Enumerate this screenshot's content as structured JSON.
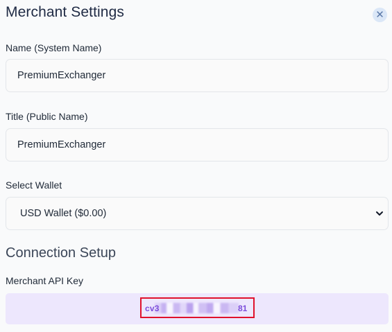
{
  "modal": {
    "title": "Merchant Settings",
    "close_icon": "close-icon"
  },
  "form": {
    "name_label": "Name (System Name)",
    "name_value": "PremiumExchanger",
    "title_label": "Title (Public Name)",
    "title_value": "PremiumExchanger",
    "wallet_label": "Select Wallet",
    "wallet_selected": "USD Wallet ($0.00)"
  },
  "connection": {
    "section_title": "Connection Setup",
    "api_key_label": "Merchant API Key",
    "api_key_prefix": "cv3",
    "api_key_suffix": "81"
  },
  "colors": {
    "accent": "#7c4ddb",
    "api_key_bg": "#ede7fd",
    "highlight_border": "#e0112b"
  }
}
